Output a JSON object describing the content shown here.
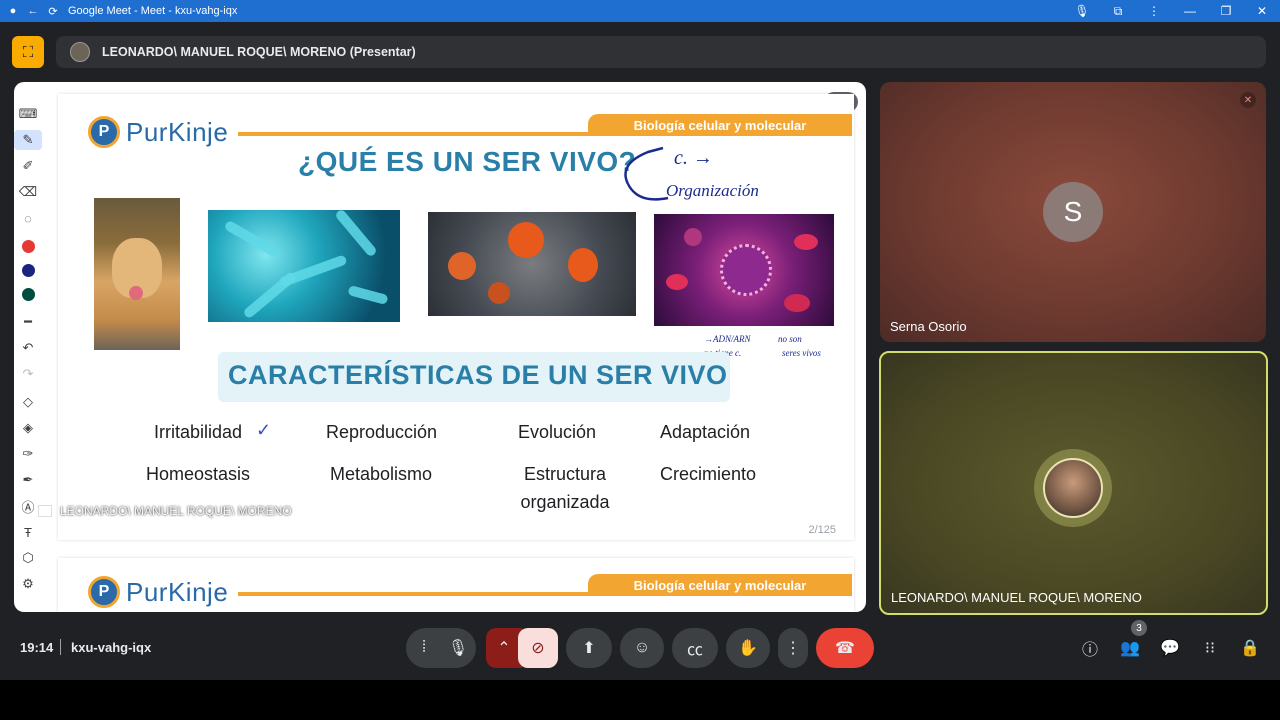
{
  "window": {
    "title": "Google Meet - Meet - kxu-vahg-iqx"
  },
  "presenter_bar": {
    "label": "LEONARDO\\ MANUEL ROQUE\\ MORENO (Presentar)"
  },
  "slide": {
    "brand": "PurKinje",
    "banner": "Biología celular y molecular",
    "heading": "¿QUÉ ES UN SER VIVO?",
    "annotation_top": "C. ⟶ Organización",
    "annotation_virus": "ADN/ARN no tiene c. · no son seres vivos",
    "caption": "CARACTERÍSTICAS DE UN SER VIVO",
    "traits": [
      "Irritabilidad",
      "Reproducción",
      "Evolución",
      "Adaptación",
      "Homeostasis",
      "Metabolismo",
      "Estructura organizada",
      "Crecimiento"
    ],
    "page": "2/125"
  },
  "slide2": {
    "brand": "PurKinje",
    "banner": "Biología celular y molecular"
  },
  "overlay_name": "LEONARDO\\ MANUEL ROQUE\\ MORENO",
  "tiles": [
    {
      "name": "Serna Osorio",
      "initial": "S",
      "muted": true
    },
    {
      "name": "LEONARDO\\ MANUEL ROQUE\\ MORENO"
    }
  ],
  "bottombar": {
    "time": "19:14",
    "meeting_code": "kxu-vahg-iqx",
    "participants_count": "3"
  },
  "colors": {
    "accent": "#f2a531",
    "heading": "#2a7fa8",
    "end_call": "#ea4335",
    "title_bar": "#1f6fd1"
  }
}
